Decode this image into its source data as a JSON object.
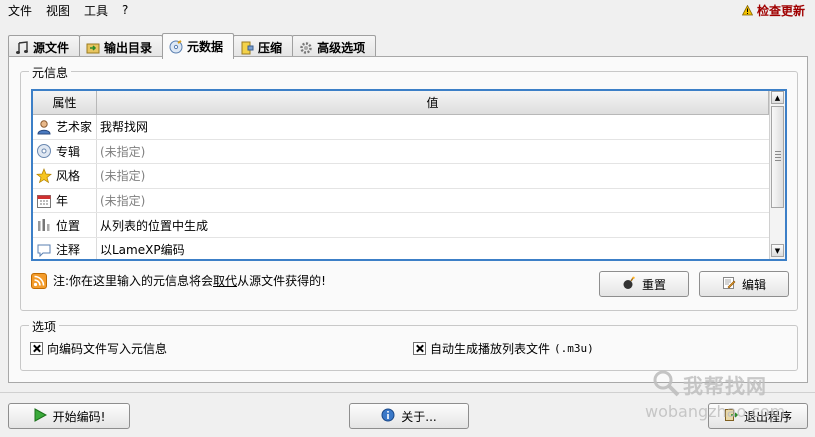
{
  "menu": [
    "文件",
    "视图",
    "工具",
    "?"
  ],
  "update_check": "检查更新",
  "tabs": [
    {
      "label": "源文件",
      "icon": "music-note-icon"
    },
    {
      "label": "输出目录",
      "icon": "folder-arrow-icon"
    },
    {
      "label": "元数据",
      "icon": "metadata-disc-icon"
    },
    {
      "label": "压缩",
      "icon": "compress-icon"
    },
    {
      "label": "高级选项",
      "icon": "gear-icon"
    }
  ],
  "active_tab": "元数据",
  "metadata": {
    "group_title": "元信息",
    "header_key": "属性",
    "header_value": "值",
    "rows": [
      {
        "key": "艺术家",
        "value": "我帮找网",
        "icon": "person-icon",
        "unset": false
      },
      {
        "key": "专辑",
        "value": "(未指定)",
        "icon": "cd-icon",
        "unset": true
      },
      {
        "key": "风格",
        "value": "(未指定)",
        "icon": "star-icon",
        "unset": true
      },
      {
        "key": "年",
        "value": "(未指定)",
        "icon": "calendar-icon",
        "unset": true
      },
      {
        "key": "位置",
        "value": "从列表的位置中生成",
        "icon": "position-icon",
        "unset": false
      },
      {
        "key": "注释",
        "value": "以LameXP编码",
        "icon": "comment-icon",
        "unset": false
      }
    ],
    "note_prefix": "注:你在这里输入的元信息将会",
    "note_emph": "取代",
    "note_suffix": "从源文件获得的!",
    "reset_label": "重置",
    "edit_label": "编辑"
  },
  "options": {
    "group_title": "选项",
    "write_meta_label": "向编码文件写入元信息",
    "write_meta_checked": true,
    "playlist_label_prefix": "自动生成播放列表文件",
    "playlist_ext": "(.m3u)",
    "playlist_checked": true
  },
  "buttons": {
    "start": "开始编码!",
    "about": "关于...",
    "exit": "退出程序"
  },
  "watermark": {
    "line1": "我帮找网",
    "line2": "wobangzhao.com"
  },
  "colors": {
    "accent_border": "#3c7fc7",
    "update_link": "#a00000",
    "unset_text": "#808080"
  }
}
